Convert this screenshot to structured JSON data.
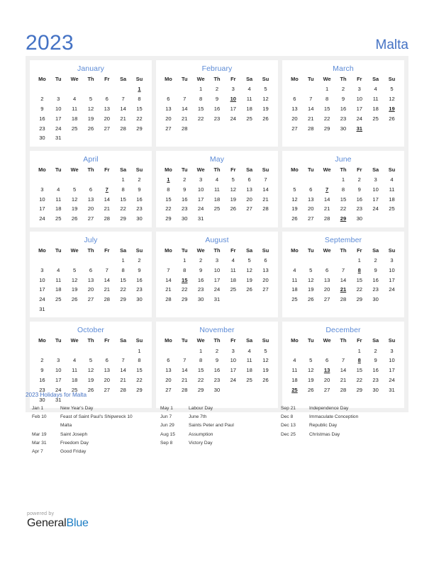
{
  "header": {
    "year": "2023",
    "country": "Malta",
    "accent_color": "#4472c4",
    "holiday_color": "#e60000"
  },
  "calendar": {
    "weekday_headers": [
      "Mo",
      "Tu",
      "We",
      "Th",
      "Fr",
      "Sa",
      "Su"
    ],
    "months": [
      {
        "name": "January",
        "weeks": [
          [
            "",
            "",
            "",
            "",
            "",
            "",
            "1"
          ],
          [
            "2",
            "3",
            "4",
            "5",
            "6",
            "7",
            "8"
          ],
          [
            "9",
            "10",
            "11",
            "12",
            "13",
            "14",
            "15"
          ],
          [
            "16",
            "17",
            "18",
            "19",
            "20",
            "21",
            "22"
          ],
          [
            "23",
            "24",
            "25",
            "26",
            "27",
            "28",
            "29"
          ],
          [
            "30",
            "31",
            "",
            "",
            "",
            "",
            ""
          ]
        ],
        "holidays": [
          "1"
        ]
      },
      {
        "name": "February",
        "weeks": [
          [
            "",
            "",
            "1",
            "2",
            "3",
            "4",
            "5"
          ],
          [
            "6",
            "7",
            "8",
            "9",
            "10",
            "11",
            "12"
          ],
          [
            "13",
            "14",
            "15",
            "16",
            "17",
            "18",
            "19"
          ],
          [
            "20",
            "21",
            "22",
            "23",
            "24",
            "25",
            "26"
          ],
          [
            "27",
            "28",
            "",
            "",
            "",
            "",
            ""
          ]
        ],
        "holidays": [
          "10"
        ]
      },
      {
        "name": "March",
        "weeks": [
          [
            "",
            "",
            "1",
            "2",
            "3",
            "4",
            "5"
          ],
          [
            "6",
            "7",
            "8",
            "9",
            "10",
            "11",
            "12"
          ],
          [
            "13",
            "14",
            "15",
            "16",
            "17",
            "18",
            "19"
          ],
          [
            "20",
            "21",
            "22",
            "23",
            "24",
            "25",
            "26"
          ],
          [
            "27",
            "28",
            "29",
            "30",
            "31",
            "",
            ""
          ]
        ],
        "holidays": [
          "19",
          "31"
        ]
      },
      {
        "name": "April",
        "weeks": [
          [
            "",
            "",
            "",
            "",
            "",
            "1",
            "2"
          ],
          [
            "3",
            "4",
            "5",
            "6",
            "7",
            "8",
            "9"
          ],
          [
            "10",
            "11",
            "12",
            "13",
            "14",
            "15",
            "16"
          ],
          [
            "17",
            "18",
            "19",
            "20",
            "21",
            "22",
            "23"
          ],
          [
            "24",
            "25",
            "26",
            "27",
            "28",
            "29",
            "30"
          ]
        ],
        "holidays": [
          "7"
        ]
      },
      {
        "name": "May",
        "weeks": [
          [
            "1",
            "2",
            "3",
            "4",
            "5",
            "6",
            "7"
          ],
          [
            "8",
            "9",
            "10",
            "11",
            "12",
            "13",
            "14"
          ],
          [
            "15",
            "16",
            "17",
            "18",
            "19",
            "20",
            "21"
          ],
          [
            "22",
            "23",
            "24",
            "25",
            "26",
            "27",
            "28"
          ],
          [
            "29",
            "30",
            "31",
            "",
            "",
            "",
            ""
          ]
        ],
        "holidays": [
          "1"
        ]
      },
      {
        "name": "June",
        "weeks": [
          [
            "",
            "",
            "",
            "1",
            "2",
            "3",
            "4"
          ],
          [
            "5",
            "6",
            "7",
            "8",
            "9",
            "10",
            "11"
          ],
          [
            "12",
            "13",
            "14",
            "15",
            "16",
            "17",
            "18"
          ],
          [
            "19",
            "20",
            "21",
            "22",
            "23",
            "24",
            "25"
          ],
          [
            "26",
            "27",
            "28",
            "29",
            "30",
            "",
            ""
          ]
        ],
        "holidays": [
          "7",
          "29"
        ]
      },
      {
        "name": "July",
        "weeks": [
          [
            "",
            "",
            "",
            "",
            "",
            "1",
            "2"
          ],
          [
            "3",
            "4",
            "5",
            "6",
            "7",
            "8",
            "9"
          ],
          [
            "10",
            "11",
            "12",
            "13",
            "14",
            "15",
            "16"
          ],
          [
            "17",
            "18",
            "19",
            "20",
            "21",
            "22",
            "23"
          ],
          [
            "24",
            "25",
            "26",
            "27",
            "28",
            "29",
            "30"
          ],
          [
            "31",
            "",
            "",
            "",
            "",
            "",
            ""
          ]
        ],
        "holidays": []
      },
      {
        "name": "August",
        "weeks": [
          [
            "",
            "1",
            "2",
            "3",
            "4",
            "5",
            "6"
          ],
          [
            "7",
            "8",
            "9",
            "10",
            "11",
            "12",
            "13"
          ],
          [
            "14",
            "15",
            "16",
            "17",
            "18",
            "19",
            "20"
          ],
          [
            "21",
            "22",
            "23",
            "24",
            "25",
            "26",
            "27"
          ],
          [
            "28",
            "29",
            "30",
            "31",
            "",
            "",
            ""
          ]
        ],
        "holidays": [
          "15"
        ]
      },
      {
        "name": "September",
        "weeks": [
          [
            "",
            "",
            "",
            "",
            "1",
            "2",
            "3"
          ],
          [
            "4",
            "5",
            "6",
            "7",
            "8",
            "9",
            "10"
          ],
          [
            "11",
            "12",
            "13",
            "14",
            "15",
            "16",
            "17"
          ],
          [
            "18",
            "19",
            "20",
            "21",
            "22",
            "23",
            "24"
          ],
          [
            "25",
            "26",
            "27",
            "28",
            "29",
            "30",
            ""
          ]
        ],
        "holidays": [
          "8",
          "21"
        ]
      },
      {
        "name": "October",
        "weeks": [
          [
            "",
            "",
            "",
            "",
            "",
            "",
            "1"
          ],
          [
            "2",
            "3",
            "4",
            "5",
            "6",
            "7",
            "8"
          ],
          [
            "9",
            "10",
            "11",
            "12",
            "13",
            "14",
            "15"
          ],
          [
            "16",
            "17",
            "18",
            "19",
            "20",
            "21",
            "22"
          ],
          [
            "23",
            "24",
            "25",
            "26",
            "27",
            "28",
            "29"
          ],
          [
            "30",
            "31",
            "",
            "",
            "",
            "",
            ""
          ]
        ],
        "holidays": []
      },
      {
        "name": "November",
        "weeks": [
          [
            "",
            "",
            "1",
            "2",
            "3",
            "4",
            "5"
          ],
          [
            "6",
            "7",
            "8",
            "9",
            "10",
            "11",
            "12"
          ],
          [
            "13",
            "14",
            "15",
            "16",
            "17",
            "18",
            "19"
          ],
          [
            "20",
            "21",
            "22",
            "23",
            "24",
            "25",
            "26"
          ],
          [
            "27",
            "28",
            "29",
            "30",
            "",
            "",
            ""
          ]
        ],
        "holidays": []
      },
      {
        "name": "December",
        "weeks": [
          [
            "",
            "",
            "",
            "",
            "1",
            "2",
            "3"
          ],
          [
            "4",
            "5",
            "6",
            "7",
            "8",
            "9",
            "10"
          ],
          [
            "11",
            "12",
            "13",
            "14",
            "15",
            "16",
            "17"
          ],
          [
            "18",
            "19",
            "20",
            "21",
            "22",
            "23",
            "24"
          ],
          [
            "25",
            "26",
            "27",
            "28",
            "29",
            "30",
            "31"
          ]
        ],
        "holidays": [
          "8",
          "13",
          "25"
        ]
      }
    ]
  },
  "legend": {
    "title": "2023 Holidays for Malta",
    "columns": [
      [
        {
          "date": "Jan 1",
          "name": "New Year's Day"
        },
        {
          "date": "Feb 10",
          "name": "Feast of Saint Paul's Shipwreck 10"
        },
        {
          "date": "",
          "name": "Malta"
        },
        {
          "date": "Mar 19",
          "name": "Saint Joseph"
        },
        {
          "date": "Mar 31",
          "name": "Freedom Day"
        },
        {
          "date": "Apr 7",
          "name": "Good Friday"
        }
      ],
      [
        {
          "date": "May 1",
          "name": "Labour Day"
        },
        {
          "date": "Jun 7",
          "name": "June 7th"
        },
        {
          "date": "Jun 29",
          "name": "Saints Peter and Paul"
        },
        {
          "date": "Aug 15",
          "name": "Assumption"
        },
        {
          "date": "Sep 8",
          "name": "Victory Day"
        }
      ],
      [
        {
          "date": "Sep 21",
          "name": "Independence Day"
        },
        {
          "date": "Dec 8",
          "name": "Immaculate Conception"
        },
        {
          "date": "Dec 13",
          "name": "Republic Day"
        },
        {
          "date": "Dec 25",
          "name": "Christmas Day"
        }
      ]
    ]
  },
  "footer": {
    "powered_by": "powered by",
    "brand_part1": "General",
    "brand_part2": "Blue"
  }
}
